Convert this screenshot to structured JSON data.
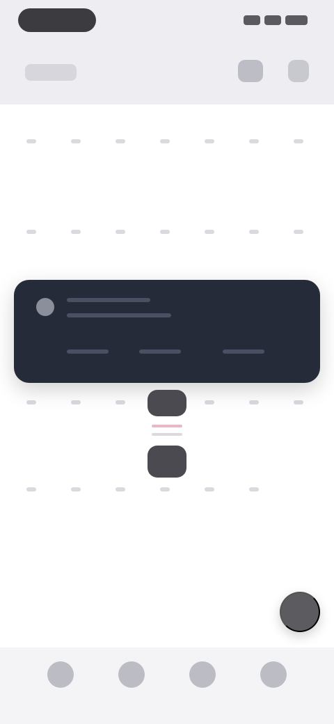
{
  "status_bar": {
    "time": "",
    "icons": [
      "signal-icon",
      "wifi-icon",
      "battery-icon"
    ]
  },
  "header": {
    "title": "",
    "actions": [
      "person-icon",
      "menu-icon"
    ]
  },
  "event_card": {
    "title": "",
    "subtitle": ""
  },
  "fab": {
    "icon": "plus-icon"
  },
  "tabbar": {
    "tabs": [
      "home-icon",
      "calendar-icon",
      "search-icon",
      "profile-icon"
    ]
  },
  "colors": {
    "background": "#eeeef2",
    "card": "#252b38",
    "accent": "#e7b9c4",
    "fab": "#5b5b60"
  }
}
